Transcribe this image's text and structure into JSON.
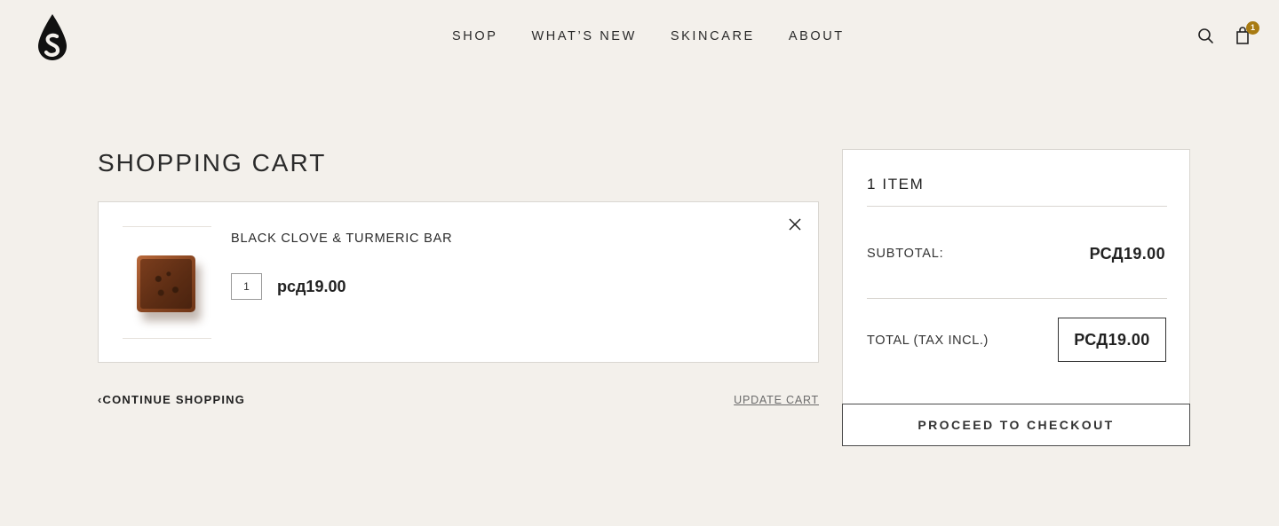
{
  "header": {
    "logo_name": "drop-logo",
    "nav": [
      {
        "label": "SHOP"
      },
      {
        "label": "WHAT’S NEW"
      },
      {
        "label": "SKINCARE"
      },
      {
        "label": "ABOUT"
      }
    ],
    "cart_count": "1"
  },
  "page": {
    "title": "SHOPPING CART"
  },
  "cart": {
    "items": [
      {
        "name": "BLACK CLOVE & TURMERIC BAR",
        "quantity": "1",
        "price": "рсд19.00"
      }
    ],
    "continue_label": "‹CONTINUE SHOPPING",
    "update_label": "UPDATE CART"
  },
  "summary": {
    "item_count": "1 ITEM",
    "subtotal_label": "SUBTOTAL:",
    "subtotal_value": "РСД19.00",
    "total_label": "TOTAL (TAX INCL.)",
    "total_value": "РСД19.00",
    "checkout_label": "PROCEED TO CHECKOUT"
  },
  "colors": {
    "background": "#f3f0eb",
    "badge": "#a87b12",
    "text": "#222222"
  }
}
